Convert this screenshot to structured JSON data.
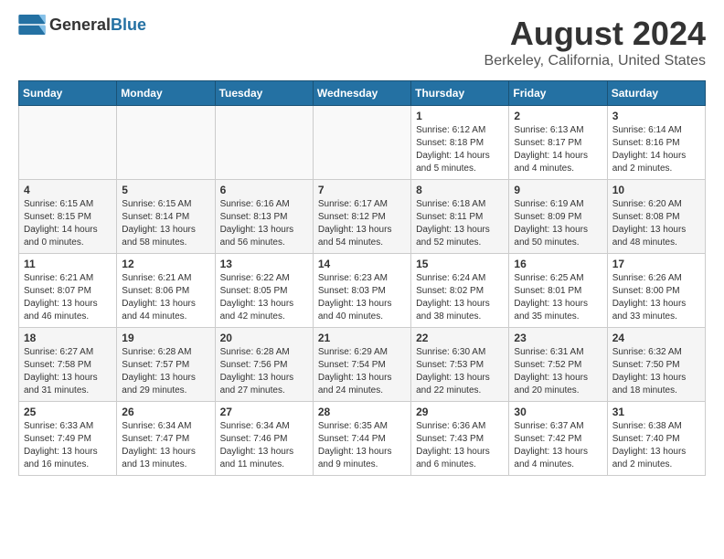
{
  "header": {
    "logo_general": "General",
    "logo_blue": "Blue",
    "title": "August 2024",
    "subtitle": "Berkeley, California, United States"
  },
  "calendar": {
    "days_of_week": [
      "Sunday",
      "Monday",
      "Tuesday",
      "Wednesday",
      "Thursday",
      "Friday",
      "Saturday"
    ],
    "weeks": [
      [
        {
          "day": "",
          "info": ""
        },
        {
          "day": "",
          "info": ""
        },
        {
          "day": "",
          "info": ""
        },
        {
          "day": "",
          "info": ""
        },
        {
          "day": "1",
          "info": "Sunrise: 6:12 AM\nSunset: 8:18 PM\nDaylight: 14 hours\nand 5 minutes."
        },
        {
          "day": "2",
          "info": "Sunrise: 6:13 AM\nSunset: 8:17 PM\nDaylight: 14 hours\nand 4 minutes."
        },
        {
          "day": "3",
          "info": "Sunrise: 6:14 AM\nSunset: 8:16 PM\nDaylight: 14 hours\nand 2 minutes."
        }
      ],
      [
        {
          "day": "4",
          "info": "Sunrise: 6:15 AM\nSunset: 8:15 PM\nDaylight: 14 hours\nand 0 minutes."
        },
        {
          "day": "5",
          "info": "Sunrise: 6:15 AM\nSunset: 8:14 PM\nDaylight: 13 hours\nand 58 minutes."
        },
        {
          "day": "6",
          "info": "Sunrise: 6:16 AM\nSunset: 8:13 PM\nDaylight: 13 hours\nand 56 minutes."
        },
        {
          "day": "7",
          "info": "Sunrise: 6:17 AM\nSunset: 8:12 PM\nDaylight: 13 hours\nand 54 minutes."
        },
        {
          "day": "8",
          "info": "Sunrise: 6:18 AM\nSunset: 8:11 PM\nDaylight: 13 hours\nand 52 minutes."
        },
        {
          "day": "9",
          "info": "Sunrise: 6:19 AM\nSunset: 8:09 PM\nDaylight: 13 hours\nand 50 minutes."
        },
        {
          "day": "10",
          "info": "Sunrise: 6:20 AM\nSunset: 8:08 PM\nDaylight: 13 hours\nand 48 minutes."
        }
      ],
      [
        {
          "day": "11",
          "info": "Sunrise: 6:21 AM\nSunset: 8:07 PM\nDaylight: 13 hours\nand 46 minutes."
        },
        {
          "day": "12",
          "info": "Sunrise: 6:21 AM\nSunset: 8:06 PM\nDaylight: 13 hours\nand 44 minutes."
        },
        {
          "day": "13",
          "info": "Sunrise: 6:22 AM\nSunset: 8:05 PM\nDaylight: 13 hours\nand 42 minutes."
        },
        {
          "day": "14",
          "info": "Sunrise: 6:23 AM\nSunset: 8:03 PM\nDaylight: 13 hours\nand 40 minutes."
        },
        {
          "day": "15",
          "info": "Sunrise: 6:24 AM\nSunset: 8:02 PM\nDaylight: 13 hours\nand 38 minutes."
        },
        {
          "day": "16",
          "info": "Sunrise: 6:25 AM\nSunset: 8:01 PM\nDaylight: 13 hours\nand 35 minutes."
        },
        {
          "day": "17",
          "info": "Sunrise: 6:26 AM\nSunset: 8:00 PM\nDaylight: 13 hours\nand 33 minutes."
        }
      ],
      [
        {
          "day": "18",
          "info": "Sunrise: 6:27 AM\nSunset: 7:58 PM\nDaylight: 13 hours\nand 31 minutes."
        },
        {
          "day": "19",
          "info": "Sunrise: 6:28 AM\nSunset: 7:57 PM\nDaylight: 13 hours\nand 29 minutes."
        },
        {
          "day": "20",
          "info": "Sunrise: 6:28 AM\nSunset: 7:56 PM\nDaylight: 13 hours\nand 27 minutes."
        },
        {
          "day": "21",
          "info": "Sunrise: 6:29 AM\nSunset: 7:54 PM\nDaylight: 13 hours\nand 24 minutes."
        },
        {
          "day": "22",
          "info": "Sunrise: 6:30 AM\nSunset: 7:53 PM\nDaylight: 13 hours\nand 22 minutes."
        },
        {
          "day": "23",
          "info": "Sunrise: 6:31 AM\nSunset: 7:52 PM\nDaylight: 13 hours\nand 20 minutes."
        },
        {
          "day": "24",
          "info": "Sunrise: 6:32 AM\nSunset: 7:50 PM\nDaylight: 13 hours\nand 18 minutes."
        }
      ],
      [
        {
          "day": "25",
          "info": "Sunrise: 6:33 AM\nSunset: 7:49 PM\nDaylight: 13 hours\nand 16 minutes."
        },
        {
          "day": "26",
          "info": "Sunrise: 6:34 AM\nSunset: 7:47 PM\nDaylight: 13 hours\nand 13 minutes."
        },
        {
          "day": "27",
          "info": "Sunrise: 6:34 AM\nSunset: 7:46 PM\nDaylight: 13 hours\nand 11 minutes."
        },
        {
          "day": "28",
          "info": "Sunrise: 6:35 AM\nSunset: 7:44 PM\nDaylight: 13 hours\nand 9 minutes."
        },
        {
          "day": "29",
          "info": "Sunrise: 6:36 AM\nSunset: 7:43 PM\nDaylight: 13 hours\nand 6 minutes."
        },
        {
          "day": "30",
          "info": "Sunrise: 6:37 AM\nSunset: 7:42 PM\nDaylight: 13 hours\nand 4 minutes."
        },
        {
          "day": "31",
          "info": "Sunrise: 6:38 AM\nSunset: 7:40 PM\nDaylight: 13 hours\nand 2 minutes."
        }
      ]
    ]
  }
}
